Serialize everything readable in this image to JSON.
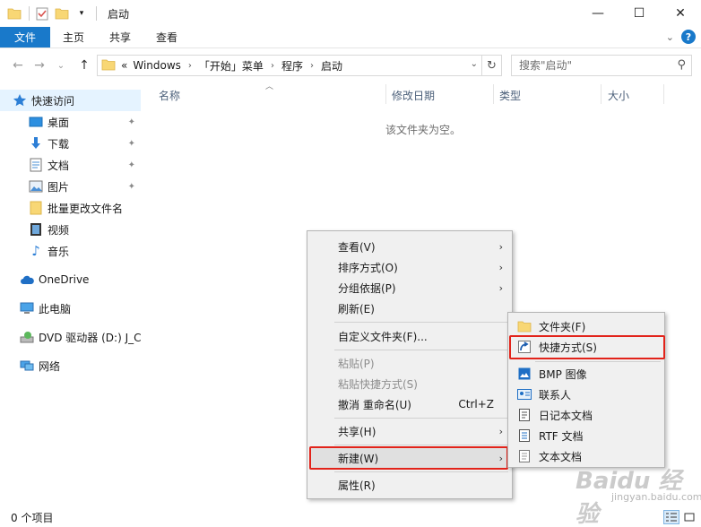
{
  "window": {
    "title": "启动",
    "controls": {
      "minimize": "—",
      "maximize": "☐",
      "close": "✕"
    }
  },
  "ribbon": {
    "tabs": [
      "文件",
      "主页",
      "共享",
      "查看"
    ],
    "expand_glyph": "⌄",
    "help_glyph": "?"
  },
  "nav": {
    "back": "←",
    "forward": "→",
    "recent": "⌄",
    "up": "↑",
    "breadcrumb_overflow": "«",
    "breadcrumb": [
      "Windows",
      "「开始」菜单",
      "程序",
      "启动"
    ],
    "search_placeholder": "搜索\"启动\""
  },
  "sidebar": {
    "items": [
      {
        "label": "快速访问",
        "icon": "star-icon",
        "pinned": false
      },
      {
        "label": "桌面",
        "icon": "desktop-icon",
        "pinned": true
      },
      {
        "label": "下载",
        "icon": "download-icon",
        "pinned": true
      },
      {
        "label": "文档",
        "icon": "document-icon",
        "pinned": true
      },
      {
        "label": "图片",
        "icon": "picture-icon",
        "pinned": true
      },
      {
        "label": "批量更改文件名",
        "icon": "folder-icon",
        "pinned": false
      },
      {
        "label": "视频",
        "icon": "video-icon",
        "pinned": false
      },
      {
        "label": "音乐",
        "icon": "music-icon",
        "pinned": false
      },
      {
        "label": "OneDrive",
        "icon": "cloud-icon",
        "pinned": false
      },
      {
        "label": "此电脑",
        "icon": "computer-icon",
        "pinned": false
      },
      {
        "label": "DVD 驱动器 (D:) J_C",
        "icon": "dvd-icon",
        "pinned": false
      },
      {
        "label": "网络",
        "icon": "network-icon",
        "pinned": false
      }
    ]
  },
  "content": {
    "columns": [
      "名称",
      "修改日期",
      "类型",
      "大小"
    ],
    "empty_message": "该文件夹为空。"
  },
  "context_menu": {
    "items": [
      {
        "label": "查看(V)",
        "submenu": true
      },
      {
        "label": "排序方式(O)",
        "submenu": true
      },
      {
        "label": "分组依据(P)",
        "submenu": true
      },
      {
        "label": "刷新(E)"
      },
      {
        "label": "自定义文件夹(F)..."
      },
      {
        "label": "粘贴(P)",
        "disabled": true
      },
      {
        "label": "粘贴快捷方式(S)",
        "disabled": true
      },
      {
        "label": "撤消 重命名(U)",
        "shortcut": "Ctrl+Z"
      },
      {
        "label": "共享(H)",
        "submenu": true
      },
      {
        "label": "新建(W)",
        "submenu": true,
        "highlighted": true
      },
      {
        "label": "属性(R)"
      }
    ]
  },
  "new_submenu": {
    "items": [
      {
        "label": "文件夹(F)",
        "icon": "folder-icon"
      },
      {
        "label": "快捷方式(S)",
        "icon": "shortcut-icon",
        "highlighted": true
      },
      {
        "label": "BMP 图像",
        "icon": "bmp-image-icon"
      },
      {
        "label": "联系人",
        "icon": "contact-icon"
      },
      {
        "label": "日记本文档",
        "icon": "journal-icon"
      },
      {
        "label": "RTF 文档",
        "icon": "rtf-document-icon"
      },
      {
        "label": "文本文档",
        "icon": "text-document-icon"
      }
    ]
  },
  "status": {
    "item_count": "0 个项目"
  },
  "watermark": {
    "brand": "Baidu 经验",
    "url": "jingyan.baidu.com"
  },
  "colors": {
    "accent": "#1979ca",
    "highlight_box": "#e2231a",
    "selection": "#e5f3ff",
    "menu_bg": "#f0f0f0"
  }
}
